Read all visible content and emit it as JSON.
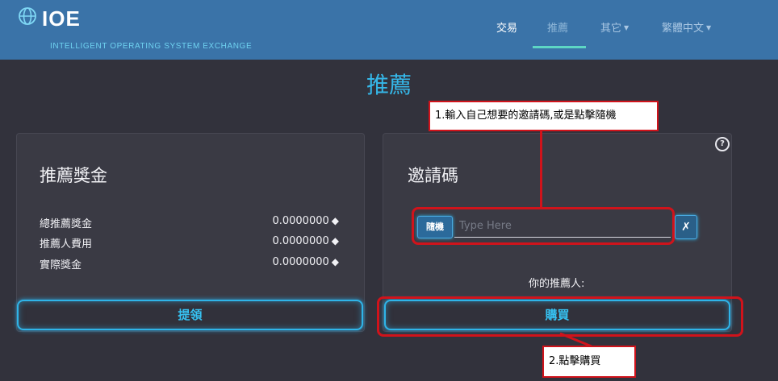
{
  "header": {
    "logo": "IOE",
    "subtitle": "INTELLIGENT OPERATING SYSTEM EXCHANGE",
    "nav": [
      {
        "label": "交易"
      },
      {
        "label": "推薦"
      },
      {
        "label": "其它"
      },
      {
        "label": "繁體中文"
      }
    ]
  },
  "page_title": "推薦",
  "reward_panel": {
    "heading": "推薦獎金",
    "rows": [
      {
        "label": "總推薦獎金",
        "value": "0.0000000"
      },
      {
        "label": "推薦人費用",
        "value": "0.0000000"
      },
      {
        "label": "實際獎金",
        "value": "0.0000000"
      }
    ],
    "withdraw_label": "提領"
  },
  "invite_panel": {
    "heading": "邀請碼",
    "help_icon": "?",
    "random_label": "隨機",
    "input_placeholder": "Type Here",
    "input_value": "",
    "clear_label": "✗",
    "referrer_label": "你的推薦人:",
    "buy_label": "購買"
  },
  "annotations": {
    "note1": "1.輸入自己想要的邀請碼,或是點擊隨機",
    "note2": "2.點擊購買"
  },
  "colors": {
    "header_bg": "#3a73a8",
    "page_bg": "#32323c",
    "accent": "#35b7e8",
    "annotation_red": "#d0131b"
  }
}
